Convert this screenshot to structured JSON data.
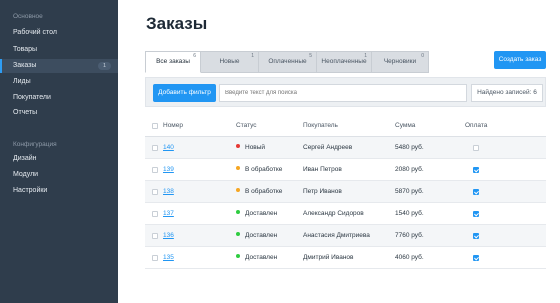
{
  "sidebar": {
    "section_main": "Основное",
    "items": [
      {
        "label": "Рабочий стол"
      },
      {
        "label": "Товары"
      },
      {
        "label": "Заказы",
        "badge": "1"
      },
      {
        "label": "Лиды"
      },
      {
        "label": "Покупатели"
      },
      {
        "label": "Отчеты"
      }
    ],
    "section_config": "Конфигурация",
    "config_items": [
      {
        "label": "Дизайн"
      },
      {
        "label": "Модули"
      },
      {
        "label": "Настройки"
      }
    ]
  },
  "main": {
    "title": "Заказы",
    "tabs": [
      {
        "label": "Все заказы",
        "count": "6"
      },
      {
        "label": "Новые",
        "count": "1"
      },
      {
        "label": "Оплаченные",
        "count": "5"
      },
      {
        "label": "Неоплаченные",
        "count": "1"
      },
      {
        "label": "Черновики",
        "count": "0"
      }
    ],
    "create_button": "Создать заказ",
    "filter_button": "Добавить фильтр",
    "search_placeholder": "Введите текст для поиска",
    "found_label": "Найдено записей: 6",
    "columns": {
      "num": "Номер",
      "status": "Статус",
      "buyer": "Покупатель",
      "sum": "Сумма",
      "paid": "Оплата"
    },
    "rows": [
      {
        "num": "140",
        "status": "Новый",
        "status_color": "#e53935",
        "buyer": "Сергей Андреев",
        "sum": "5480 руб.",
        "paid": false
      },
      {
        "num": "139",
        "status": "В обработке",
        "status_color": "#f5a623",
        "buyer": "Иван Петров",
        "sum": "2080 руб.",
        "paid": true
      },
      {
        "num": "138",
        "status": "В обработке",
        "status_color": "#f5a623",
        "buyer": "Петр Иванов",
        "sum": "5870 руб.",
        "paid": true
      },
      {
        "num": "137",
        "status": "Доставлен",
        "status_color": "#2ecc40",
        "buyer": "Александр Сидоров",
        "sum": "1540 руб.",
        "paid": true
      },
      {
        "num": "136",
        "status": "Доставлен",
        "status_color": "#2ecc40",
        "buyer": "Анастасия Дмитриева",
        "sum": "7760 руб.",
        "paid": true
      },
      {
        "num": "135",
        "status": "Доставлен",
        "status_color": "#2ecc40",
        "buyer": "Дмитрий Иванов",
        "sum": "4060 руб.",
        "paid": true
      }
    ]
  },
  "colors": {
    "sidebar_bg": "#2f3d4c",
    "accent": "#2196f3"
  }
}
